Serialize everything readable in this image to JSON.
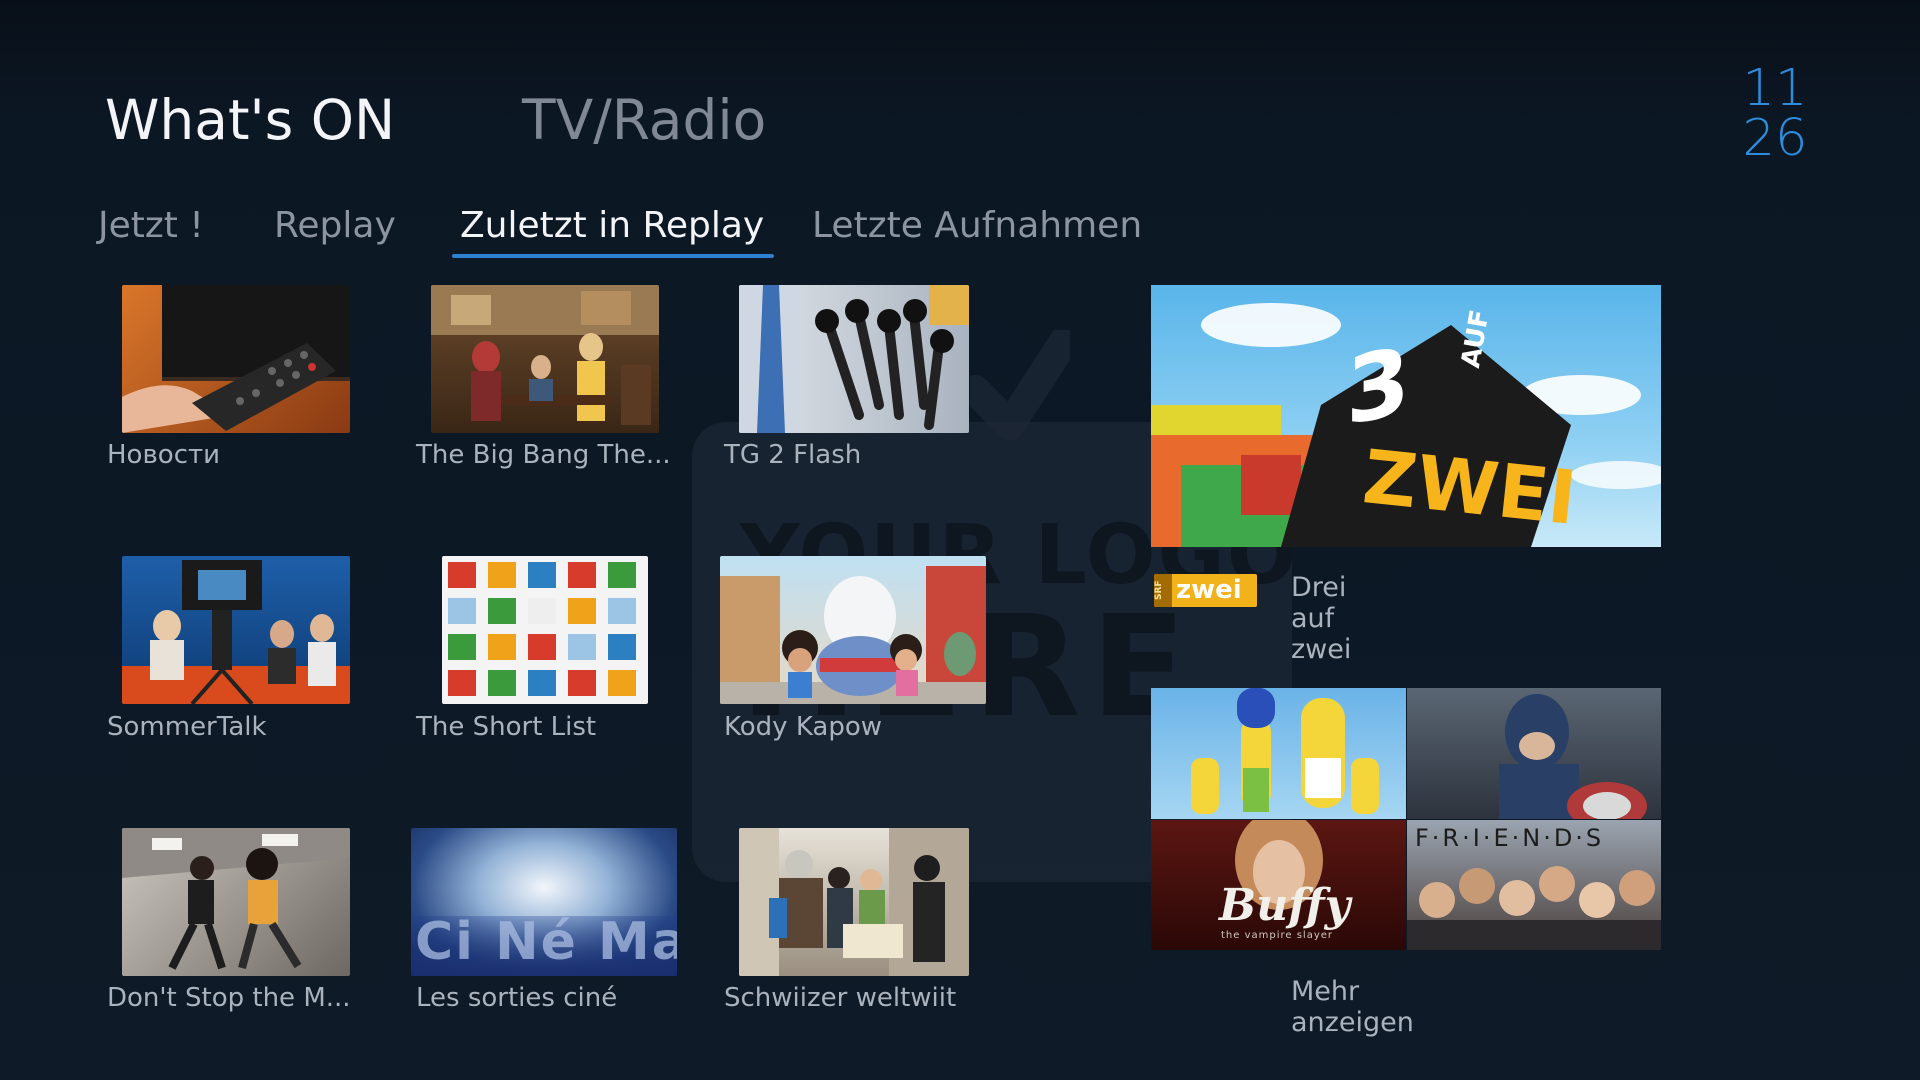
{
  "header": {
    "primary_tabs": [
      {
        "label": "What's ON",
        "active": true
      },
      {
        "label": "TV/Radio",
        "active": false
      }
    ],
    "clock": {
      "hour": "11",
      "minute": "26"
    }
  },
  "subtabs": [
    {
      "label": "Jetzt !",
      "active": false
    },
    {
      "label": "Replay",
      "active": false
    },
    {
      "label": "Zuletzt in Replay",
      "active": true
    },
    {
      "label": "Letzte Aufnahmen",
      "active": false
    }
  ],
  "watermark": {
    "line1": "YOUR LOGO",
    "line2": "HERE"
  },
  "grid": [
    {
      "title": "Новости"
    },
    {
      "title": "The Big Bang The..."
    },
    {
      "title": "TG 2 Flash"
    },
    {
      "title": "SommerTalk"
    },
    {
      "title": "The Short List"
    },
    {
      "title": "Kody Kapow"
    },
    {
      "title": "Don't Stop the M..."
    },
    {
      "title": "Les sorties ciné",
      "thumb_text": "Ci Né Ma"
    },
    {
      "title": "Schwiizer weltwiit"
    }
  ],
  "featured": {
    "title": "Drei auf zwei",
    "art_text_top": "3",
    "art_text_side": "AUF",
    "art_text_main": "ZWEI",
    "channel_logo": {
      "prefix": "SRF",
      "name": "zwei"
    }
  },
  "more": {
    "label": "Mehr anzeigen",
    "mosaic_text": {
      "friends": "F·R·I·E·N·D·S",
      "buffy": "Buffy",
      "buffy_sub": "the vampire slayer"
    }
  },
  "colors": {
    "background": "#0b1521",
    "accent": "#2f7fd3",
    "clock": "#2e8cdd",
    "label": "#aab2bd"
  }
}
